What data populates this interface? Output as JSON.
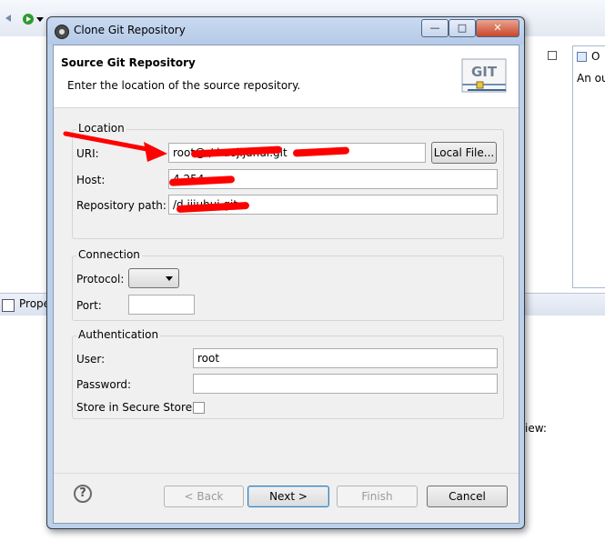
{
  "workbench": {
    "outline_tab": "O",
    "outline_text": "An ou",
    "properties_tab": "Prope",
    "view_text": "iew:"
  },
  "dialog": {
    "title": "Clone Git Repository",
    "header_title": "Source Git Repository",
    "header_desc": "Enter the location of the source repository.",
    "logo_text": "GIT"
  },
  "location": {
    "legend": "Location",
    "uri_label": "URI:",
    "uri_value": "root@                       /d                    aojijuhui.git",
    "local_file_button": "Local File...",
    "host_label": "Host:",
    "host_value": "                 4.254",
    "repo_path_label": "Repository path:",
    "repo_path_value": "/d                      ijjuhui.git"
  },
  "connection": {
    "legend": "Connection",
    "protocol_label": "Protocol:",
    "protocol_value": "",
    "port_label": "Port:",
    "port_value": ""
  },
  "authentication": {
    "legend": "Authentication",
    "user_label": "User:",
    "user_value": "root",
    "password_label": "Password:",
    "password_value": "",
    "store_label": "Store in Secure Store",
    "store_checked": false
  },
  "buttons": {
    "help": "?",
    "back": "< Back",
    "next": "Next >",
    "finish": "Finish",
    "cancel": "Cancel"
  },
  "colors": {
    "annotation": "#ff0000",
    "dialog_frame": "#bcd0ea"
  }
}
